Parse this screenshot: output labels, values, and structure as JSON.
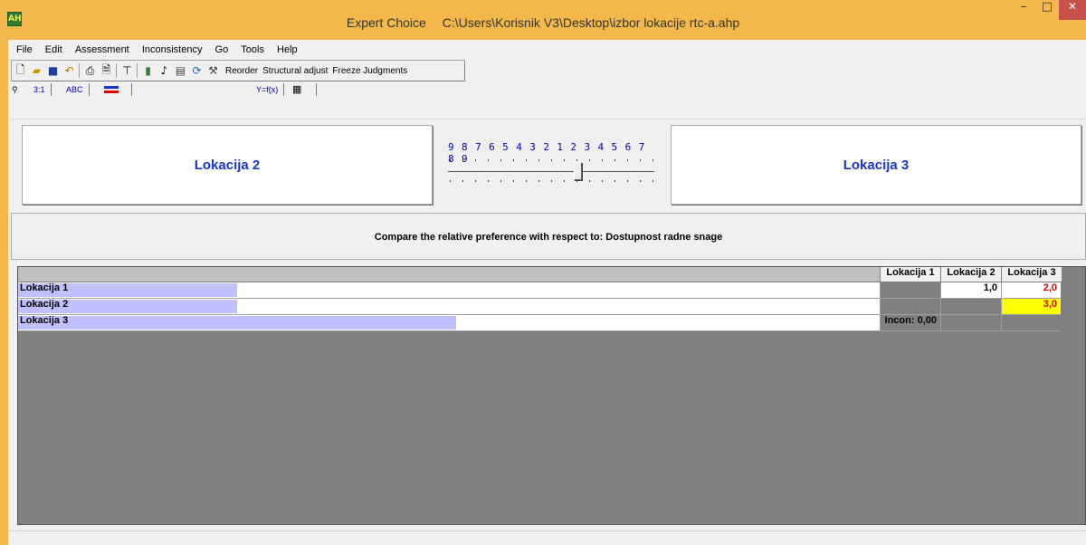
{
  "window": {
    "app_name": "Expert Choice",
    "file_path": "C:\\Users\\Korisnik V3\\Desktop\\izbor lokacije rtc-a.ahp",
    "min_glyph": "–",
    "max_glyph": "□",
    "close_glyph": "✕",
    "icon_glyph": "AH"
  },
  "menu": [
    "File",
    "Edit",
    "Assessment",
    "Inconsistency",
    "Go",
    "Tools",
    "Help"
  ],
  "toolbar": {
    "reorder": "Reorder",
    "structural_adjust": "Structural adjust",
    "freeze_judgments": "Freeze Judgments"
  },
  "tabs": {
    "numeric": "3:1",
    "verbal": "ABC",
    "graphical": "",
    "formula": "Y=f(x)",
    "table": ""
  },
  "comparison": {
    "left_item": "Lokacija 2",
    "right_item": "Lokacija 3",
    "scale": "9 8 7 6 5 4 3 2 1 2 3 4 5 6 7 8 9",
    "prompt": "Compare the relative preference  with respect to: Dostupnost radne snage"
  },
  "matrix": {
    "columns": [
      "Lokacija 1",
      "Lokacija 2",
      "Lokacija 3"
    ],
    "rows": [
      {
        "label": "Lokacija 1",
        "bar_fraction": 0.21,
        "cells": [
          "",
          "1,0",
          "2,0"
        ]
      },
      {
        "label": "Lokacija 2",
        "bar_fraction": 0.21,
        "cells": [
          "",
          "",
          "3,0"
        ]
      },
      {
        "label": "Lokacija 3",
        "bar_fraction": 0.42,
        "cells": [
          "Incon: 0,00",
          "",
          ""
        ]
      }
    ]
  },
  "colors": {
    "accent_blue": "#1a33cc",
    "inverse_red": "#e00000",
    "highlight_yellow": "#ffff00",
    "priority_bar": "#c0c0ff"
  }
}
